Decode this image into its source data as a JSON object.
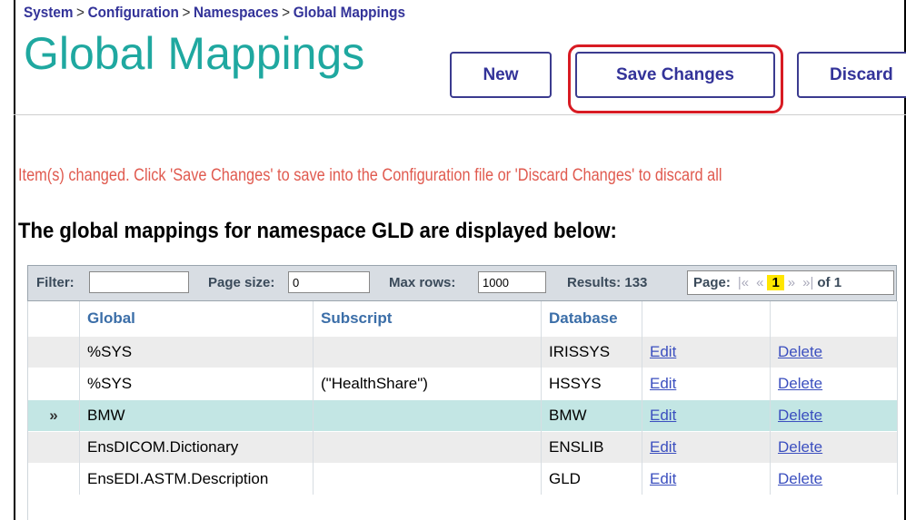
{
  "breadcrumb": {
    "items": [
      "System",
      "Configuration",
      "Namespaces",
      "Global Mappings"
    ],
    "separator": ">"
  },
  "page_title": "Global Mappings",
  "toolbar": {
    "new_label": "New",
    "save_label": "Save Changes",
    "discard_label": "Discard"
  },
  "message": "Item(s) changed. Click 'Save Changes' to save into the Configuration file or 'Discard Changes' to discard all",
  "subheading": "The global mappings for namespace GLD are displayed below:",
  "filter_bar": {
    "filter_label": "Filter:",
    "filter_value": "",
    "page_size_label": "Page size:",
    "page_size_value": "0",
    "max_rows_label": "Max rows:",
    "max_rows_value": "1000",
    "results_label": "Results: 133",
    "page_label": "Page:",
    "first": "|«",
    "prev": "«",
    "current_page": "1",
    "next": "»",
    "last": "»|",
    "of_label": "of 1"
  },
  "table": {
    "columns": [
      "Global",
      "Subscript",
      "Database",
      "",
      ""
    ],
    "rows": [
      {
        "marker": "",
        "global": "%SYS",
        "subscript": "",
        "database": "IRISSYS",
        "edit": "Edit",
        "delete": "Delete"
      },
      {
        "marker": "",
        "global": "%SYS",
        "subscript": "(\"HealthShare\")",
        "database": "HSSYS",
        "edit": "Edit",
        "delete": "Delete"
      },
      {
        "marker": "»",
        "global": "BMW",
        "subscript": "",
        "database": "BMW",
        "edit": "Edit",
        "delete": "Delete"
      },
      {
        "marker": "",
        "global": "EnsDICOM.Dictionary",
        "subscript": "",
        "database": "ENSLIB",
        "edit": "Edit",
        "delete": "Delete"
      },
      {
        "marker": "",
        "global": "EnsEDI.ASTM.Description",
        "subscript": "",
        "database": "GLD",
        "edit": "Edit",
        "delete": "Delete"
      }
    ]
  },
  "colors": {
    "title": "#1fa8a0",
    "highlight": "#d81b23",
    "message": "#e05a4f",
    "link": "#3b4fbf",
    "selected_row": "#c3e6e4"
  }
}
